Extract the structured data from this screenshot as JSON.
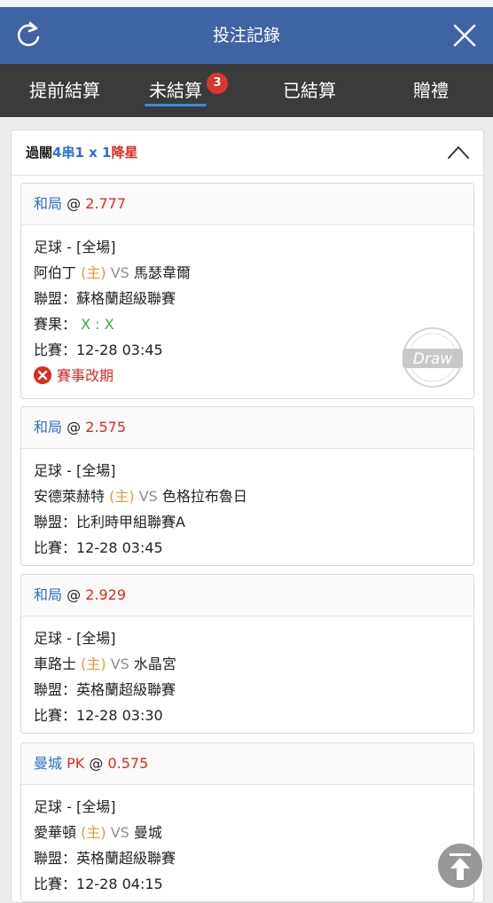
{
  "header": {
    "title": "投注記錄",
    "refresh_icon": "refresh-icon",
    "close_icon": "close-icon"
  },
  "tabs": [
    {
      "label": "提前結算"
    },
    {
      "label": "未結算",
      "badge": "3",
      "active": true
    },
    {
      "label": "已結算"
    },
    {
      "label": "贈禮"
    }
  ],
  "summary": {
    "part1": "過關",
    "part2": "4串1 x 1",
    "part3": "降星"
  },
  "bets": [
    {
      "pick": "和局",
      "pk": "",
      "at": "@",
      "odds": "2.777",
      "sport": "足球 - [全場]",
      "home_team": "阿伯丁",
      "home_tag": "(主)",
      "vs": "VS",
      "away_team": "馬瑟韋爾",
      "league": "聯盟：蘇格蘭超級聯賽",
      "result_label": "賽果：",
      "result_value": "X : X",
      "match_time": "比賽：12-28 03:45",
      "status": "賽事改期",
      "stamp": "Draw"
    },
    {
      "pick": "和局",
      "pk": "",
      "at": "@",
      "odds": "2.575",
      "sport": "足球 - [全場]",
      "home_team": "安德萊赫特",
      "home_tag": "(主)",
      "vs": "VS",
      "away_team": "色格拉布魯日",
      "league": "聯盟：比利時甲組聯賽A",
      "match_time": "比賽：12-28 03:45"
    },
    {
      "pick": "和局",
      "pk": "",
      "at": "@",
      "odds": "2.929",
      "sport": "足球 - [全場]",
      "home_team": "車路士",
      "home_tag": "(主)",
      "vs": "VS",
      "away_team": "水晶宮",
      "league": "聯盟：英格蘭超級聯賽",
      "match_time": "比賽：12-28 03:30"
    },
    {
      "pick": "曼城",
      "pk": "PK",
      "at": "@",
      "odds": "0.575",
      "sport": "足球 - [全場]",
      "home_team": "愛華頓",
      "home_tag": "(主)",
      "vs": "VS",
      "away_team": "曼城",
      "league": "聯盟：英格蘭超級聯賽",
      "match_time": "比賽：12-28 04:15"
    }
  ],
  "colors": {
    "header_bg": "#3f64a4",
    "tabbar_bg": "#3b3b3b",
    "accent_red": "#e02a1f",
    "accent_blue": "#2f6cc6",
    "home_orange": "#e8963a"
  },
  "scroll_top_icon": "scroll-to-top-icon"
}
